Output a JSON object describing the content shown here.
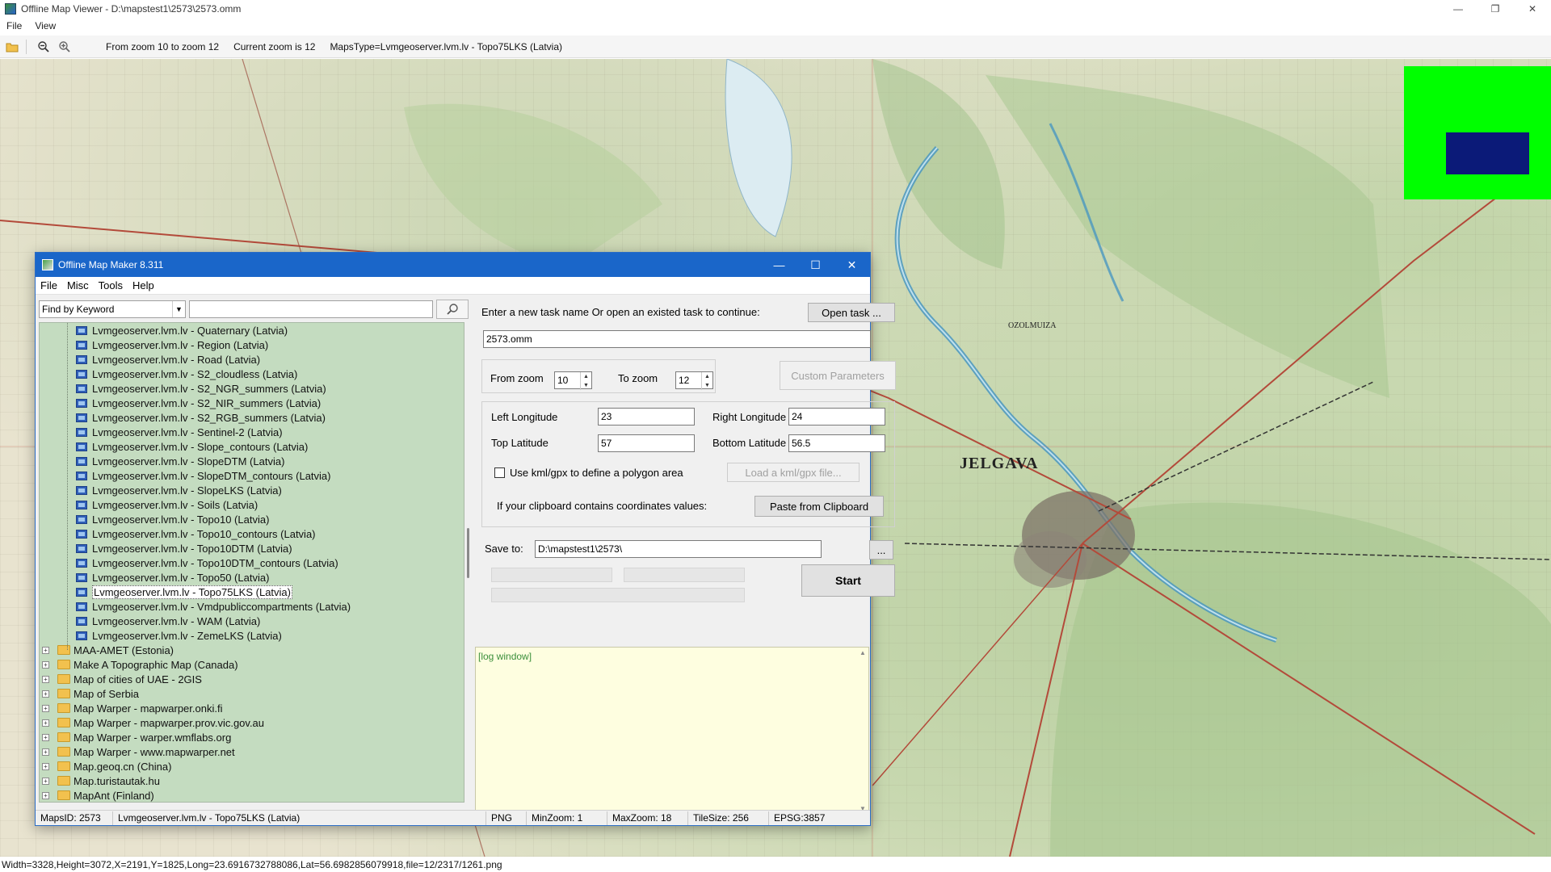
{
  "viewer": {
    "title": "Offline Map Viewer - D:\\mapstest1\\2573\\2573.omm",
    "menu": [
      "File",
      "View"
    ],
    "toolbar": {
      "zoom_range": "From zoom 10 to zoom 12",
      "current_zoom": "Current zoom is 12",
      "maps_type": "MapsType=Lvmgeoserver.lvm.lv - Topo75LKS (Latvia)"
    },
    "map_labels": {
      "city": "JELGAVA",
      "town": "OZOLMUIZA"
    },
    "status": "Width=3328,Height=3072,X=2191,Y=1825,Long=23.6916732788086,Lat=56.6982856079918,file=12/2317/1261.png"
  },
  "dialog": {
    "title": "Offline Map Maker 8.311",
    "menu": [
      "File",
      "Misc",
      "Tools",
      "Help"
    ],
    "search": {
      "mode": "Find by Keyword",
      "keyword": ""
    },
    "tree": {
      "leaves": [
        "Lvmgeoserver.lvm.lv - Quaternary (Latvia)",
        "Lvmgeoserver.lvm.lv - Region (Latvia)",
        "Lvmgeoserver.lvm.lv - Road (Latvia)",
        "Lvmgeoserver.lvm.lv - S2_cloudless (Latvia)",
        "Lvmgeoserver.lvm.lv - S2_NGR_summers (Latvia)",
        "Lvmgeoserver.lvm.lv - S2_NIR_summers (Latvia)",
        "Lvmgeoserver.lvm.lv - S2_RGB_summers (Latvia)",
        "Lvmgeoserver.lvm.lv - Sentinel-2 (Latvia)",
        "Lvmgeoserver.lvm.lv - Slope_contours (Latvia)",
        "Lvmgeoserver.lvm.lv - SlopeDTM (Latvia)",
        "Lvmgeoserver.lvm.lv - SlopeDTM_contours (Latvia)",
        "Lvmgeoserver.lvm.lv - SlopeLKS (Latvia)",
        "Lvmgeoserver.lvm.lv - Soils (Latvia)",
        "Lvmgeoserver.lvm.lv - Topo10 (Latvia)",
        "Lvmgeoserver.lvm.lv - Topo10_contours (Latvia)",
        "Lvmgeoserver.lvm.lv - Topo10DTM (Latvia)",
        "Lvmgeoserver.lvm.lv - Topo10DTM_contours (Latvia)",
        "Lvmgeoserver.lvm.lv - Topo50 (Latvia)",
        "Lvmgeoserver.lvm.lv - Topo75LKS (Latvia)",
        "Lvmgeoserver.lvm.lv - Vmdpubliccompartments (Latvia)",
        "Lvmgeoserver.lvm.lv - WAM (Latvia)",
        "Lvmgeoserver.lvm.lv - ZemeLKS (Latvia)"
      ],
      "selected": "Lvmgeoserver.lvm.lv - Topo75LKS (Latvia)",
      "folders": [
        "MAA-AMET (Estonia)",
        "Make A Topographic Map (Canada)",
        "Map of cities of UAE - 2GIS",
        "Map of Serbia",
        "Map Warper - mapwarper.onki.fi",
        "Map Warper - mapwarper.prov.vic.gov.au",
        "Map Warper - warper.wmflabs.org",
        "Map Warper - www.mapwarper.net",
        "Map.geoq.cn (China)",
        "Map.turistautak.hu",
        "MapAnt (Finland)"
      ]
    },
    "task": {
      "prompt": "Enter a new task name Or open an existed task to continue:",
      "open_button": "Open task ...",
      "name_value": "2573.omm"
    },
    "zoom": {
      "from_label": "From zoom",
      "from_value": "10",
      "to_label": "To zoom",
      "to_value": "12",
      "custom_button": "Custom Parameters"
    },
    "coords": {
      "left_lon_label": "Left Longitude",
      "left_lon": "23",
      "right_lon_label": "Right Longitude",
      "right_lon": "24",
      "top_lat_label": "Top Latitude",
      "top_lat": "57",
      "bottom_lat_label": "Bottom Latitude",
      "bottom_lat": "56.5",
      "kml_label": "Use kml/gpx to define a polygon area",
      "kml_checked": false,
      "load_kml_button": "Load a kml/gpx file...",
      "clipboard_label": "If your clipboard contains coordinates values:",
      "paste_button": "Paste from Clipboard"
    },
    "save": {
      "label": "Save to:",
      "path": "D:\\mapstest1\\2573\\",
      "browse_button": "...",
      "start_button": "Start"
    },
    "log": {
      "label": "[log window]"
    },
    "status": {
      "maps_id": "MapsID: 2573",
      "maps_name": "Lvmgeoserver.lvm.lv - Topo75LKS (Latvia)",
      "format": "PNG",
      "min_zoom": "MinZoom: 1",
      "max_zoom": "MaxZoom: 18",
      "tile_size": "TileSize: 256",
      "epsg": "EPSG:3857"
    }
  }
}
